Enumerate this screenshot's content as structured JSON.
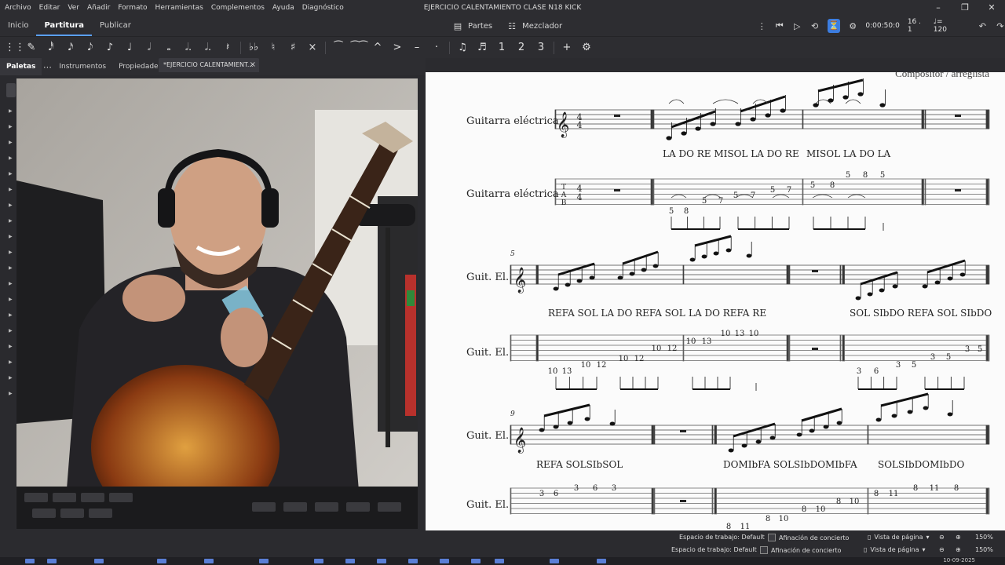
{
  "menu": [
    "Archivo",
    "Editar",
    "Ver",
    "Añadir",
    "Formato",
    "Herramientas",
    "Complementos",
    "Ayuda",
    "Diagnóstico"
  ],
  "window_title": "EJERCICIO CALENTAMIENTO CLASE N18 KICK",
  "nav": {
    "tabs": [
      "Inicio",
      "Partitura",
      "Publicar"
    ],
    "active_tab": "Partitura",
    "parts_label": "Partes",
    "mixer_label": "Mezclador"
  },
  "playback": {
    "time": "0:00:50:0",
    "position": "16 . 1",
    "tempo": "♩= 120"
  },
  "toolbar_glyphs": [
    "✎",
    "𝅘𝅥𝅰",
    "𝅘𝅥𝅯",
    "𝅘𝅥𝅮",
    "♪",
    "♩",
    "𝅗𝅥",
    "𝅝",
    "𝅗𝅥.",
    "𝅗𝅥.",
    "𝄽",
    "♭♭",
    "♮",
    "♯",
    "×",
    "⁀",
    "⁀⁀",
    "^",
    ">",
    "–",
    "·",
    "♫",
    "♬",
    "1",
    "2",
    "3",
    "+",
    "⚙"
  ],
  "panel": {
    "tabs": [
      "Paletas",
      "Instrumentos",
      "Propiedades"
    ],
    "doc_tab": "*EJERCICIO CALENTAMIENT..."
  },
  "score": {
    "composer": "Compositor / arreglista",
    "instrument_full": "Guitarra eléctrica",
    "instrument_short": "Guit. El.",
    "measure_numbers": [
      "5",
      "9"
    ],
    "lyrics": {
      "sys1": [
        "LA DO RE MISOL LA DO RE",
        "MISOL LA DO LA"
      ],
      "sys2": [
        "REFA SOL LA DO REFA SOL",
        "LA DO REFA RE",
        "SOL SIbDO REFA SOL SIbDO"
      ],
      "sys3": [
        "REFA SOLSIbSOL",
        "DOMIbFA SOLSIbDOMIbFA",
        "SOLSIbDOMIbDO"
      ]
    },
    "tab_frets": {
      "sys1": [
        "5",
        "8",
        "5",
        "7",
        "5",
        "7",
        "5",
        "7",
        "5",
        "8",
        "5",
        "8",
        "5"
      ],
      "sys2": [
        "10",
        "13",
        "10",
        "12",
        "10",
        "12",
        "10",
        "12",
        "10",
        "13",
        "10",
        "13",
        "10",
        "3",
        "6",
        "3",
        "5",
        "3",
        "5",
        "3",
        "5"
      ],
      "sys3": [
        "3",
        "6",
        "3",
        "6",
        "3",
        "8",
        "11",
        "8",
        "10",
        "8",
        "10",
        "8",
        "10",
        "8",
        "11",
        "8",
        "11",
        "8"
      ]
    }
  },
  "status": {
    "workspace": "Espacio de trabajo: Default",
    "concert_pitch": "Afinación de concierto",
    "page_view": "Vista de página",
    "zoom": "150%",
    "date": "10-09-2025"
  }
}
